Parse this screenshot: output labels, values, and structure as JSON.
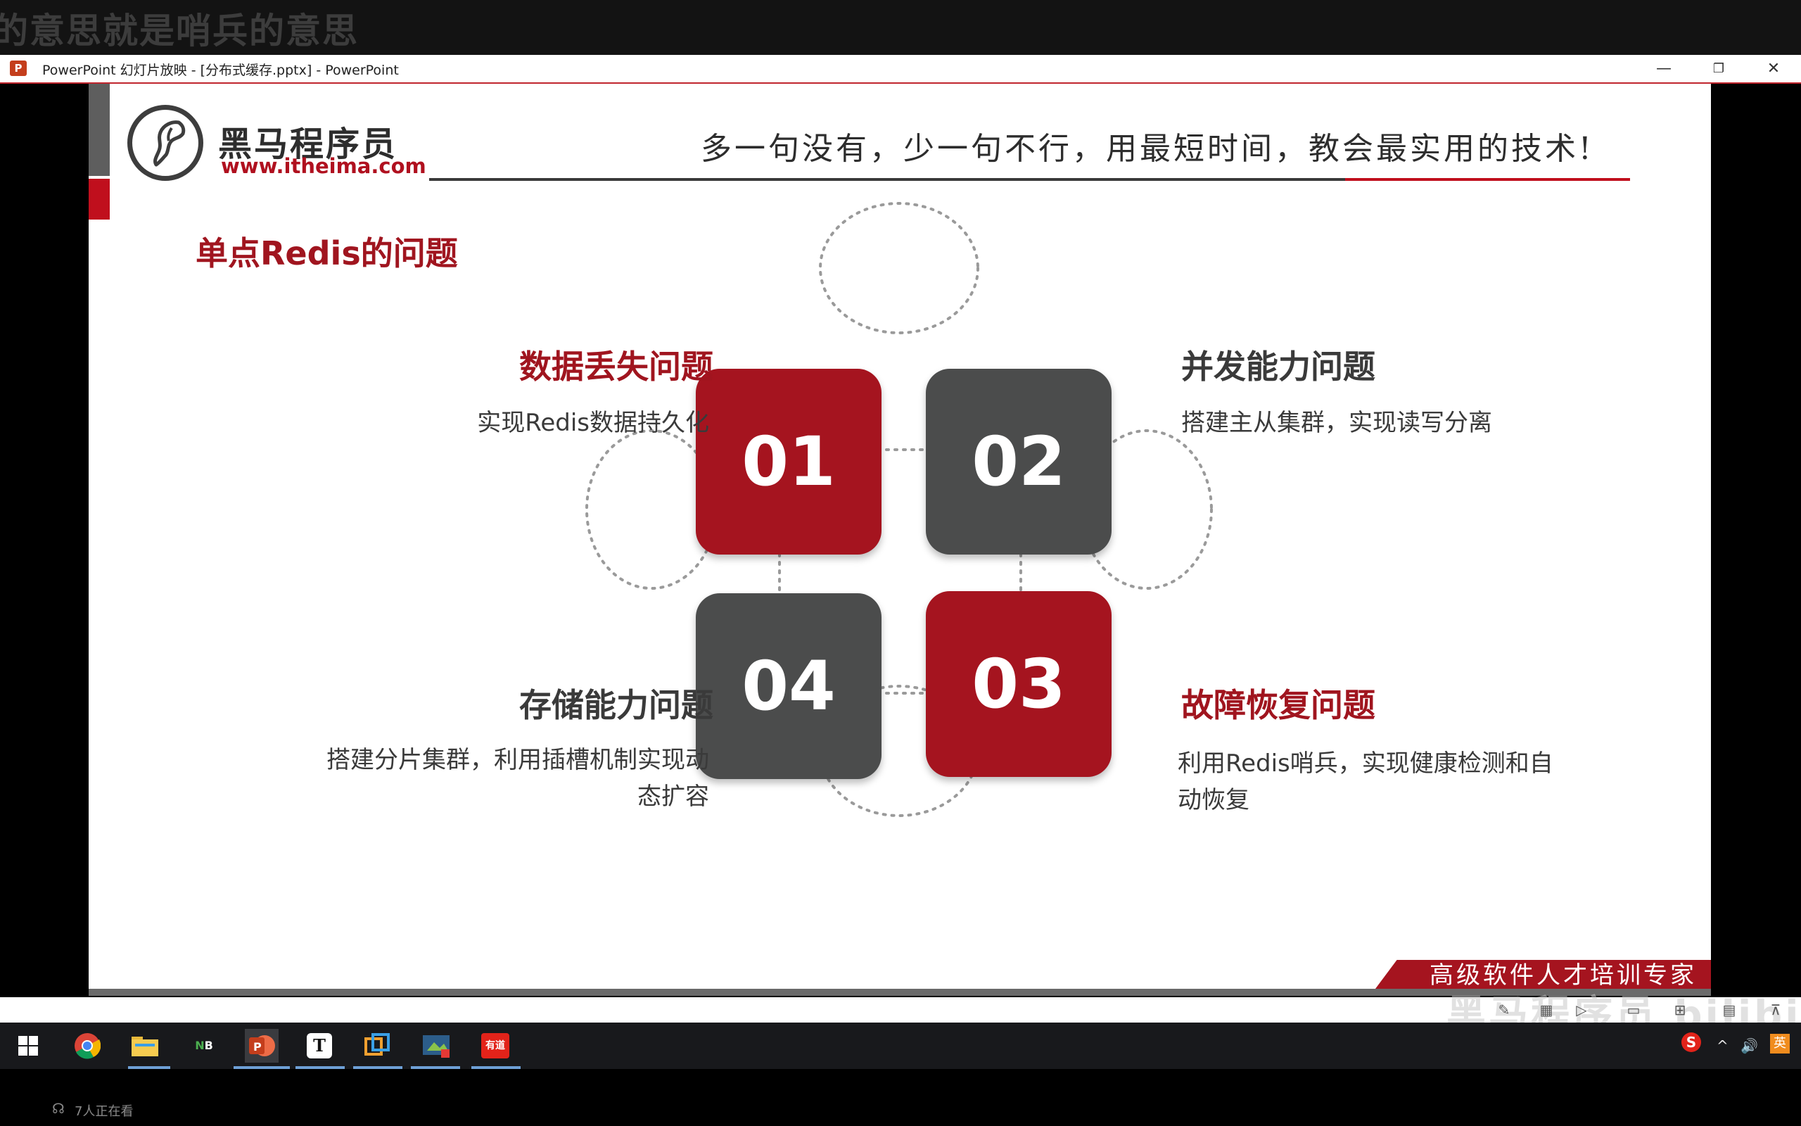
{
  "video_subtitle": "的意思就是哨兵的意思",
  "window": {
    "title": "PowerPoint 幻灯片放映 - [分布式缓存.pptx] - PowerPoint",
    "app_icon": "powerpoint-icon",
    "minimize": "—",
    "restore": "❐",
    "close": "✕"
  },
  "slide": {
    "logo_name": "黑马程序员",
    "logo_url": "www.itheima.com",
    "slogan": "多一句没有，少一句不行，用最短时间，教会最实用的技术!",
    "heading": "单点Redis的问题",
    "items": [
      {
        "number": "01",
        "title": "数据丢失问题",
        "desc": "实现Redis数据持久化",
        "color": "#a5141f"
      },
      {
        "number": "02",
        "title": "并发能力问题",
        "desc": "搭建主从集群，实现读写分离",
        "color": "#4b4c4c"
      },
      {
        "number": "03",
        "title": "故障恢复问题",
        "desc": "利用Redis哨兵，实现健康检测和自动恢复",
        "color": "#a5141f"
      },
      {
        "number": "04",
        "title": "存储能力问题",
        "desc": "搭建分片集群，利用插槽机制实现动态扩容",
        "color": "#4b4c4c"
      }
    ],
    "banner": "高级软件人才培训专家",
    "accent_red": "#a5141f",
    "accent_gray": "#4b4c4c"
  },
  "slideshow_bar": {
    "watermark": "黑马程序员 bilibili",
    "icons": [
      "pen-icon",
      "grid-icon",
      "play-icon",
      "normal-view-icon",
      "sorter-view-icon",
      "reading-view-icon",
      "slideshow-icon"
    ]
  },
  "taskbar": {
    "apps": [
      "windows-start-icon",
      "chrome-icon",
      "file-explorer-icon",
      "navicat-icon",
      "powerpoint-icon",
      "typora-icon",
      "virtualbox-icon",
      "screenshot-tool-icon",
      "youdao-icon"
    ],
    "youdao_label": "有道",
    "tray_ime": "英",
    "tray_volume": "🔊",
    "tray_chevron": "^"
  },
  "viewer_count": "7人正在看"
}
